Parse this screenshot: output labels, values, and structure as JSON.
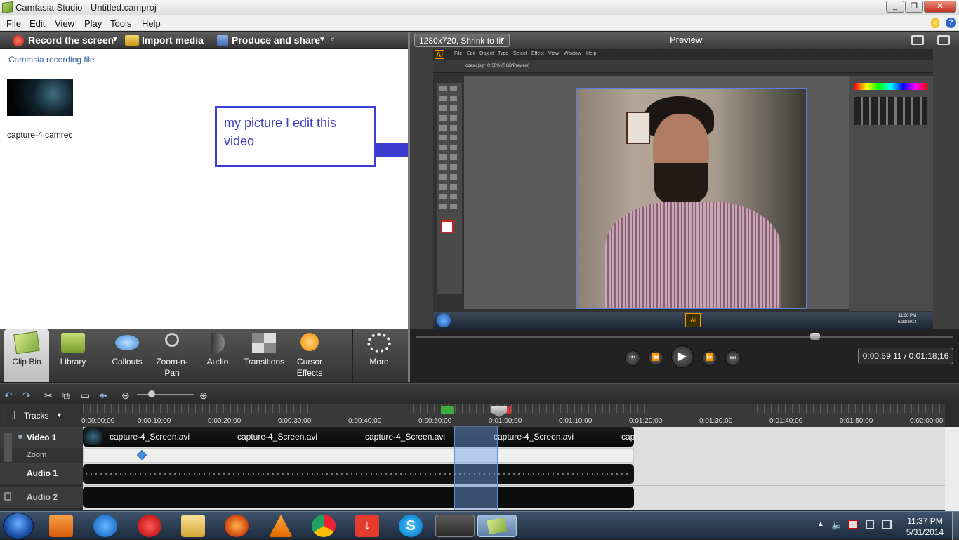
{
  "window": {
    "title": "Camtasia Studio - Untitled.camproj",
    "controls": [
      "minimize",
      "restore",
      "close"
    ]
  },
  "menu": [
    "File",
    "Edit",
    "View",
    "Play",
    "Tools",
    "Help"
  ],
  "toolstrip": {
    "record": "Record the screen",
    "import": "Import media",
    "produce": "Produce and share"
  },
  "clipbin": {
    "section": "Camtasia recording file",
    "file": "capture-4.camrec"
  },
  "annotation": {
    "text": "my picture I edit this video"
  },
  "preview": {
    "size_select": "1280x720, Shrink to fit",
    "title": "Preview",
    "timecode": "0:00:59;11 / 0:01:18;16",
    "scrub_position": 0.74
  },
  "tasks": [
    {
      "label": "Clip Bin",
      "icon": "clip-bin-icon"
    },
    {
      "label": "Library",
      "icon": "library-icon"
    },
    {
      "label": "Callouts",
      "icon": "callouts-icon"
    },
    {
      "label": "Zoom-n-\nPan",
      "icon": "zoom-icon"
    },
    {
      "label": "Audio",
      "icon": "audio-icon"
    },
    {
      "label": "Transitions",
      "icon": "transitions-icon"
    },
    {
      "label": "Cursor\nEffects",
      "icon": "cursor-effects-icon"
    },
    {
      "label": "More",
      "icon": "more-icon"
    }
  ],
  "timeline": {
    "tracks_label": "Tracks",
    "ticks": [
      "0:00:00;00",
      "0:00:10;00",
      "0:00:20;00",
      "0:00:30;00",
      "0:00:40;00",
      "0:00:50;00",
      "0:01:00;00",
      "0:01:10;00",
      "0:01:20;00",
      "0:01:30;00",
      "0:01:40;00",
      "0:01:50;00",
      "0:02:00;00"
    ],
    "tracks": [
      {
        "name": "Video 1",
        "clips": [
          "capture-4_Screen.avi",
          "capture-4_Screen.avi",
          "capture-4_Screen.avi",
          "capture-4_Screen.avi",
          "cap"
        ]
      },
      {
        "name": "Zoom"
      },
      {
        "name": "Audio 1"
      },
      {
        "name": "Audio 2"
      }
    ]
  },
  "taskbar": {
    "time": "11:37 PM",
    "date": "5/31/2014"
  },
  "embedded": {
    "ai_menu": [
      "File",
      "Edit",
      "Object",
      "Type",
      "Select",
      "Effect",
      "View",
      "Window",
      "Help"
    ],
    "doc_tab": "odesk.jpg* @ 50% (RGB/Preview)",
    "clock_time": "11:36 PM",
    "clock_date": "5/31/2014"
  }
}
